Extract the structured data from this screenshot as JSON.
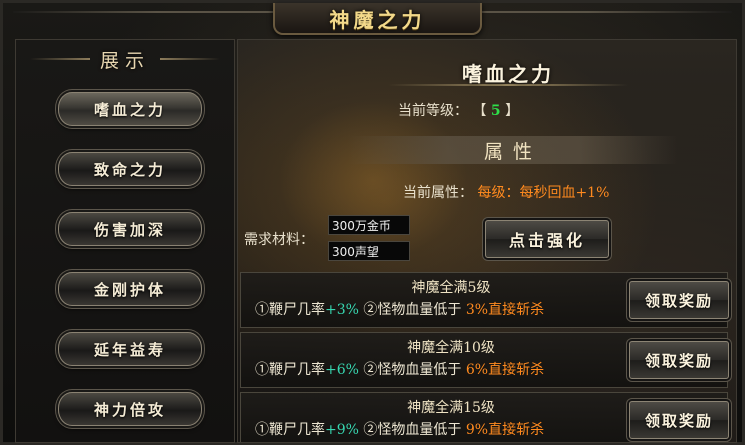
{
  "window": {
    "title": "神魔之力"
  },
  "sidebar": {
    "header": "展示",
    "items": [
      {
        "label": "嗜血之力",
        "active": true
      },
      {
        "label": "致命之力"
      },
      {
        "label": "伤害加深"
      },
      {
        "label": "金刚护体"
      },
      {
        "label": "延年益寿"
      },
      {
        "label": "神力倍攻"
      }
    ]
  },
  "main": {
    "skill_name": "嗜血之力",
    "level_label": "当前等级：",
    "level_open": "【",
    "level_value": "5",
    "level_close": "】",
    "section_title": "属性",
    "attr_label": "当前属性：",
    "attr_value": "每级：每秒回血+1%",
    "material_label": "需求材料：",
    "materials": [
      "300万金币",
      "300声望"
    ],
    "enhance_label": "点击强化"
  },
  "rewards": [
    {
      "title": "神魔全满5级",
      "p1": "①鞭尸几率",
      "v1": "+3%",
      "p2": "②怪物血量低于",
      "v2": "3%直接斩杀",
      "button": "领取奖励"
    },
    {
      "title": "神魔全满10级",
      "p1": "①鞭尸几率",
      "v1": "+6%",
      "p2": "②怪物血量低于",
      "v2": "6%直接斩杀",
      "button": "领取奖励"
    },
    {
      "title": "神魔全满15级",
      "p1": "①鞭尸几率",
      "v1": "+9%",
      "p2": "②怪物血量低于",
      "v2": "9%直接斩杀",
      "button": "领取奖励"
    }
  ],
  "colors": {
    "level_value": "#2ee04a",
    "highlight_orange": "#ff8a1f",
    "highlight_teal": "#37d6b0",
    "title_gold": "#f3d98a"
  }
}
